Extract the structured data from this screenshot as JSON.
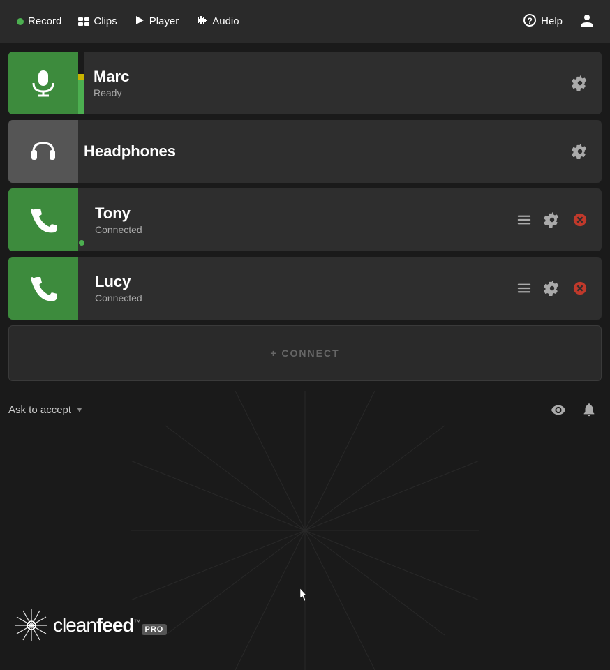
{
  "nav": {
    "record_label": "Record",
    "clips_label": "Clips",
    "player_label": "Player",
    "audio_label": "Audio",
    "help_label": "Help"
  },
  "cards": {
    "marc": {
      "name": "Marc",
      "status": "Ready"
    },
    "headphones": {
      "name": "Headphones"
    },
    "tony": {
      "name": "Tony",
      "status": "Connected"
    },
    "lucy": {
      "name": "Lucy",
      "status": "Connected"
    }
  },
  "connect": {
    "label": "+ CONNECT"
  },
  "bottom": {
    "ask_accept": "Ask to accept"
  },
  "logo": {
    "text": "cleanfeed",
    "pro": "PRO",
    "tm": "™"
  }
}
